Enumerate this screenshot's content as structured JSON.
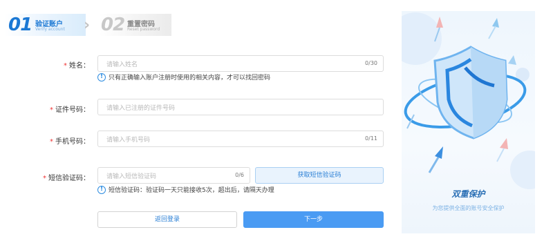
{
  "steps": [
    {
      "num": "01",
      "title": "验证账户",
      "sub": "Verify account"
    },
    {
      "num": "02",
      "title": "重置密码",
      "sub": "Reset password"
    }
  ],
  "form": {
    "name": {
      "label": "姓名：",
      "placeholder": "请输入姓名",
      "count": "0/30",
      "hint": "只有正确输入账户注册时使用的相关内容，才可以找回密码"
    },
    "id_number": {
      "label": "证件号码：",
      "placeholder": "请输入已注册的证件号码"
    },
    "phone": {
      "label": "手机号码：",
      "placeholder": "请输入手机号码",
      "count": "0/11"
    },
    "sms": {
      "label": "短信验证码：",
      "placeholder": "请输入短信验证码",
      "count": "0/6",
      "button": "获取短信验证码",
      "hint": "短信验证码：验证码一天只能接收5次，超出后，请隔天办理"
    }
  },
  "actions": {
    "back": "返回登录",
    "next": "下一步"
  },
  "panel": {
    "title": "双重保护",
    "subtitle": "为您提供全面的账号安全保护"
  },
  "colors": {
    "accent": "#4a9bf3",
    "step_active": "#1b78d4",
    "required": "#e33333"
  },
  "icons": {
    "separator": "chevron-right-icon",
    "hint": "info-icon",
    "illustration": "shield-icon"
  }
}
